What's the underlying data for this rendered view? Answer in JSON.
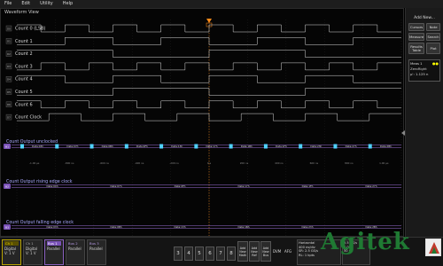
{
  "menu": [
    "File",
    "Edit",
    "Utility",
    "Help"
  ],
  "waveform_view": {
    "title": "Waveform View"
  },
  "channels": [
    {
      "tag": "D0",
      "label": "Count 0 (LSB)"
    },
    {
      "tag": "D1",
      "label": "Count 1"
    },
    {
      "tag": "D2",
      "label": "Count 2"
    },
    {
      "tag": "D3",
      "label": "Count 3"
    },
    {
      "tag": "D4",
      "label": "Count 4"
    },
    {
      "tag": "D5",
      "label": "Count 5"
    },
    {
      "tag": "D6",
      "label": "Count 6"
    },
    {
      "tag": "D7",
      "label": "Count Clock"
    }
  ],
  "bus1": {
    "tag": "B1",
    "label": "Count Output unclocked",
    "values": [
      "Data:03h",
      "Data:07h",
      "Data:0Bh",
      "Data:0Fh",
      "Data:13h",
      "Data:17h",
      "Data:1Bh",
      "Data:1Fh",
      "Data:23h",
      "Data:27h",
      "Data:2Bh"
    ]
  },
  "bus2": {
    "tag": "B2",
    "label": "Count Output rising edge clock",
    "values": [
      "Data:00h",
      "Data:07h",
      "Data:0Fh",
      "Data:17h",
      "Data:1Fh",
      "Data:27h"
    ]
  },
  "bus3": {
    "tag": "B3",
    "label": "Count Output falling edge clock",
    "values": [
      "Data:03h",
      "Data:0Bh",
      "Data:13h",
      "Data:1Bh",
      "Data:23h",
      "Data:2Bh"
    ]
  },
  "time_ticks": [
    "-1.00 μs",
    "-800 ns",
    "-600 ns",
    "-400 ns",
    "-200 ns",
    "0 s",
    "200 ns",
    "400 ns",
    "600 ns",
    "800 ns",
    "1.00 μs"
  ],
  "side": {
    "title": "Add New...",
    "buttons": [
      [
        "Cursors",
        "Note"
      ],
      [
        "Measure",
        "Search"
      ],
      [
        "Results Table",
        "Plot"
      ]
    ],
    "meas": {
      "title": "Meas 1",
      "dots": "●●",
      "name": "ZeroRight",
      "value": "μ': 1.125 n"
    }
  },
  "bottom": {
    "ch1": {
      "top": "Ch 1",
      "l1": "Digital",
      "l2": "V: 1 V"
    },
    "bus1": {
      "top": "Bus 1",
      "l1": "Parallel"
    },
    "bus2": {
      "top": "Bus 2",
      "l1": "Parallel"
    },
    "bus3": {
      "top": "Bus 3",
      "l1": "Parallel"
    },
    "nums": [
      "3",
      "4",
      "5",
      "6",
      "7",
      "8"
    ],
    "adds": [
      "Add New Math",
      "Add New Ref",
      "Add New Bus"
    ],
    "mode": "DVM",
    "aux": "AFG",
    "horizontal": {
      "title": "Horizontal",
      "l1": "400 ns/div",
      "l2": "SR: 2.5 GS/s",
      "l3": "RL: 1 kpts"
    },
    "acq": {
      "l1": "2.5 GS/s",
      "l2": "2.00",
      "l3": "50 μs"
    }
  },
  "logo": "Agitek",
  "colors": {
    "bus_line": "#9b6fd8",
    "bus_label": "#a9a9ff",
    "trace": "#d8d8d8",
    "marker": "#4fd3ff",
    "trigger": "#ff8c1a"
  }
}
